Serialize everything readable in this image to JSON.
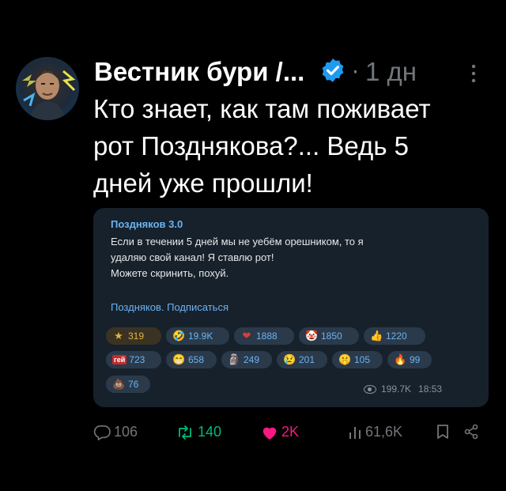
{
  "post": {
    "author": "Вестник бури /...",
    "separator": "·",
    "time": "1 дн",
    "text": "Кто знает, как там поживает\nрот Позднякова?... Ведь 5\nдней уже прошли!"
  },
  "card": {
    "channel": "Поздняков 3.0",
    "message": "Если в течении 5 дней мы не уебём орешником, то я\nудаляю свой канал! Я ставлю рот!\nМожете скринить, похуй.",
    "subscribe": "Поздняков. Подписаться",
    "reactions": [
      {
        "icon": "star-icon",
        "emoji": "★",
        "count": "319"
      },
      {
        "icon": "rofl-icon",
        "emoji": "🤣",
        "count": "19.9K"
      },
      {
        "icon": "heart-icon",
        "emoji": "❤",
        "count": "1888"
      },
      {
        "icon": "clown-icon",
        "emoji": "🤡",
        "count": "1850"
      },
      {
        "icon": "thumbs-up-icon",
        "emoji": "👍",
        "count": "1220"
      },
      {
        "icon": "gay-sticker-icon",
        "emoji": "гей",
        "count": "723"
      },
      {
        "icon": "grin-icon",
        "emoji": "😁",
        "count": "658"
      },
      {
        "icon": "avatar-sticker-icon",
        "emoji": "🗿",
        "count": "249"
      },
      {
        "icon": "cry-icon",
        "emoji": "😢",
        "count": "201"
      },
      {
        "icon": "shush-icon",
        "emoji": "🤫",
        "count": "105"
      },
      {
        "icon": "fire-icon",
        "emoji": "🔥",
        "count": "99"
      },
      {
        "icon": "poop-icon",
        "emoji": "💩",
        "count": "76"
      }
    ],
    "views": "199.7K",
    "time": "18:53"
  },
  "actions": {
    "replies": "106",
    "reposts": "140",
    "likes": "2K",
    "views": "61,6K"
  },
  "colors": {
    "accent": "#1d9bf0",
    "like": "#f91880",
    "repost": "#00ba7c",
    "muted": "#71767b",
    "card_bg": "#17212b",
    "telegram_link": "#6ab3f3"
  }
}
